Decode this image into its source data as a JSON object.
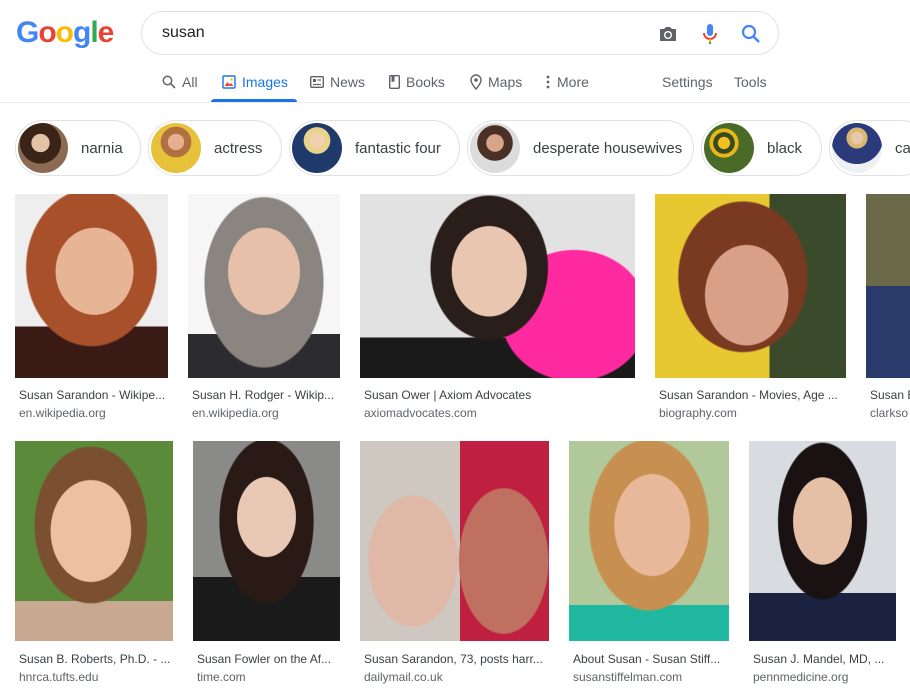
{
  "logo": {
    "letters": [
      "G",
      "o",
      "o",
      "g",
      "l",
      "e"
    ],
    "colors": [
      "#4285F4",
      "#EA4335",
      "#FBBC05",
      "#4285F4",
      "#34A853",
      "#EA4335"
    ]
  },
  "search": {
    "query": "susan"
  },
  "tabs": [
    {
      "label": "All",
      "icon": "search-icon"
    },
    {
      "label": "Images",
      "icon": "image-icon",
      "active": true
    },
    {
      "label": "News",
      "icon": "news-icon"
    },
    {
      "label": "Books",
      "icon": "book-icon"
    },
    {
      "label": "Maps",
      "icon": "map-pin-icon"
    },
    {
      "label": "More",
      "icon": "more-vert-icon"
    }
  ],
  "tools": {
    "settings": "Settings",
    "tools": "Tools"
  },
  "chips": [
    {
      "label": "narnia"
    },
    {
      "label": "actress"
    },
    {
      "label": "fantastic four"
    },
    {
      "label": "desperate housewives"
    },
    {
      "label": "black"
    },
    {
      "label": "ca"
    }
  ],
  "results": [
    {
      "title": "Susan Sarandon - Wikipe...",
      "site": "en.wikipedia.org"
    },
    {
      "title": "Susan H. Rodger - Wikip...",
      "site": "en.wikipedia.org"
    },
    {
      "title": "Susan Ower | Axiom Advocates",
      "site": "axiomadvocates.com"
    },
    {
      "title": "Susan Sarandon - Movies, Age ...",
      "site": "biography.com"
    },
    {
      "title": "Susan E",
      "site": "clarkso"
    },
    {
      "title": "Susan B. Roberts, Ph.D. - ...",
      "site": "hnrca.tufts.edu"
    },
    {
      "title": "Susan Fowler on the Af...",
      "site": "time.com"
    },
    {
      "title": "Susan Sarandon, 73, posts harr...",
      "site": "dailymail.co.uk"
    },
    {
      "title": "About Susan - Susan Stiff...",
      "site": "susanstiffelman.com"
    },
    {
      "title": "Susan J. Mandel, MD, ...",
      "site": "pennmedicine.org"
    }
  ],
  "colors": {
    "accent": "#1a73e8",
    "text_secondary": "#5f6368"
  }
}
